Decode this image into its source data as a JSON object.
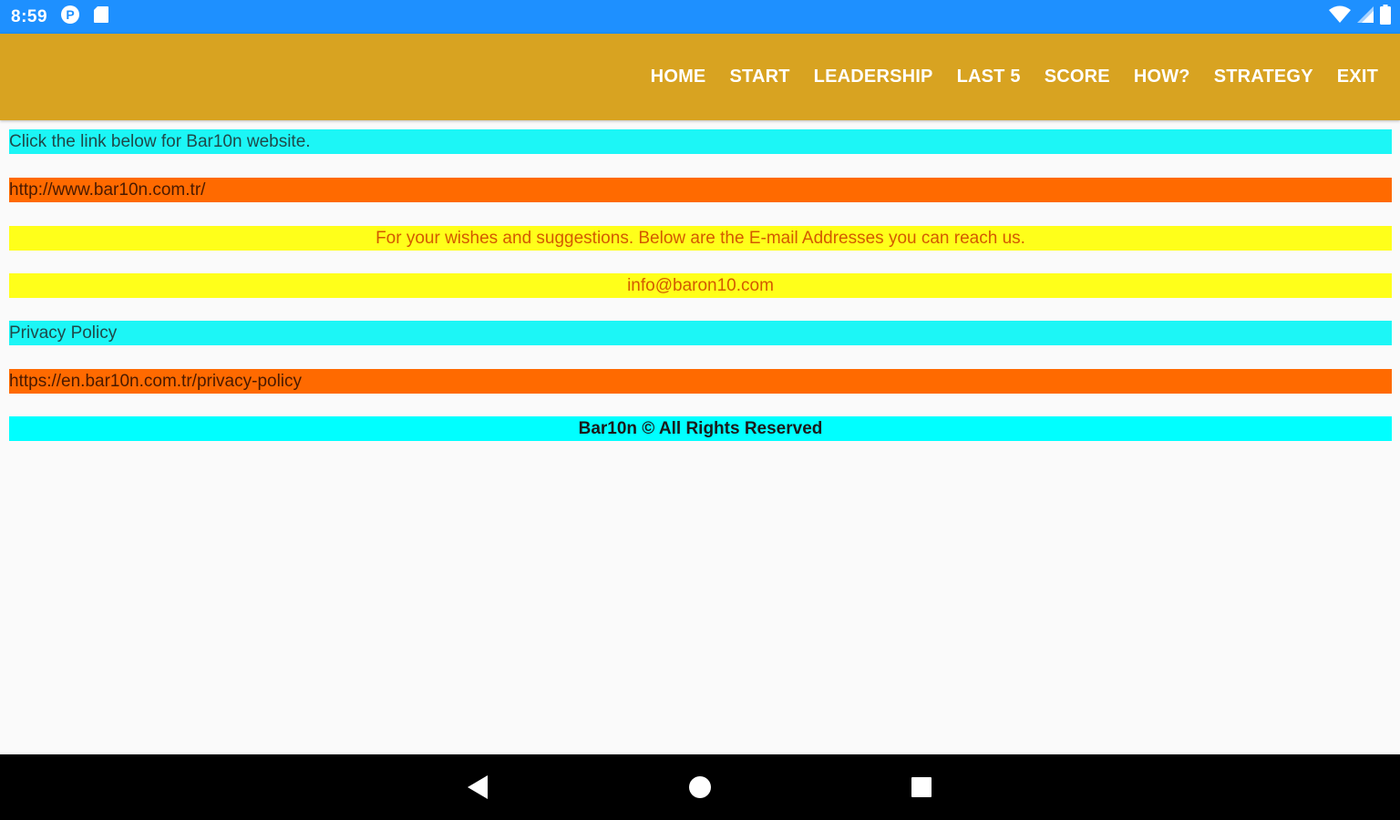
{
  "status_bar": {
    "time": "8:59",
    "left_icons": [
      "p-badge-icon",
      "sd-card-icon"
    ],
    "right_icons": [
      "wifi-icon",
      "cell-signal-icon",
      "battery-icon"
    ]
  },
  "nav": {
    "items": [
      "HOME",
      "START",
      "LEADERSHIP",
      "LAST 5",
      "SCORE",
      "HOW?",
      "STRATEGY",
      "EXIT"
    ]
  },
  "content": {
    "website_prompt": "Click the link below for Bar10n website.",
    "website_link": "http://www.bar10n.com.tr/",
    "suggestions_text": "For your wishes and suggestions. Below are the E-mail Addresses you can reach us.",
    "email": "info@baron10.com",
    "privacy_label": "Privacy Policy",
    "privacy_link": "https://en.bar10n.com.tr/privacy-policy",
    "copyright": "Bar10n © All Rights Reserved"
  },
  "colors": {
    "status_bar": "#1e90ff",
    "app_bar": "#d8a321",
    "cyan": "#1cf6f6",
    "orange": "#ff6a00",
    "yellow": "#ffff1a"
  }
}
